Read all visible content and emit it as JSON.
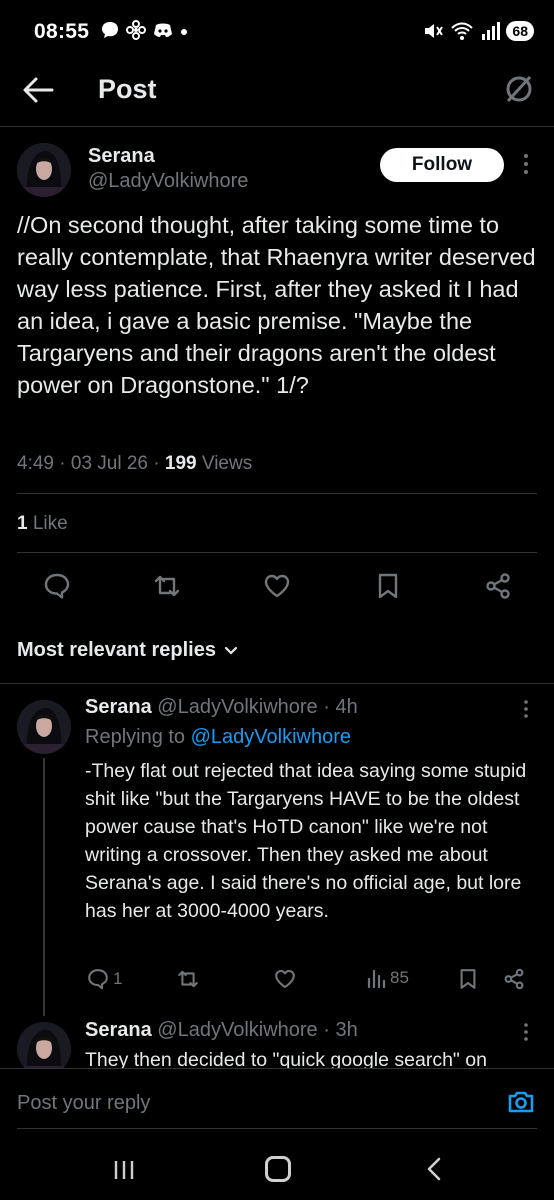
{
  "status_bar": {
    "time": "08:55",
    "battery": "68"
  },
  "header": {
    "title": "Post"
  },
  "tweet": {
    "author_name": "Serana",
    "author_handle": "@LadyVolkiwhore",
    "follow_label": "Follow",
    "text": "//On second thought, after taking some time to really contemplate, that Rhaenyra writer deserved way less patience. First, after they asked it I had an idea, i gave a basic premise. \"Maybe the Targaryens and their dragons aren't the oldest power on Dragonstone.\" 1/?",
    "time": "4:49",
    "date": "03 Jul 26",
    "views_count": "199",
    "views_label": "Views",
    "likes_count": "1",
    "likes_label": "Like"
  },
  "replies_section": {
    "label": "Most relevant replies"
  },
  "replies": [
    {
      "author_name": "Serana",
      "author_handle": "@LadyVolkiwhore",
      "age": "4h",
      "replying_to_prefix": "Replying to",
      "replying_to_handle": "@LadyVolkiwhore",
      "text": "-They flat out rejected that idea saying some stupid shit like \"but the Targaryens HAVE to be the oldest power cause that's HoTD canon\" like we're not writing a crossover. Then they asked me about Serana's age. I said there's no official age, but lore has her at 3000-4000 years.",
      "reply_count": "1",
      "views": "85"
    },
    {
      "author_name": "Serana",
      "author_handle": "@LadyVolkiwhore",
      "age": "3h",
      "text": "They then decided to \"quick google search\" on"
    }
  ],
  "compose": {
    "placeholder": "Post your reply"
  },
  "colors": {
    "background": "#000000",
    "text_primary": "#e7e9ea",
    "text_secondary": "#71767b",
    "link": "#1d9bf0",
    "divider": "#2f3336"
  },
  "icons": [
    "back-arrow-icon",
    "grok-icon",
    "more-vertical-icon",
    "reply-icon",
    "repost-icon",
    "like-icon",
    "bookmark-icon",
    "share-icon",
    "analytics-icon",
    "camera-icon",
    "chevron-down-icon"
  ]
}
